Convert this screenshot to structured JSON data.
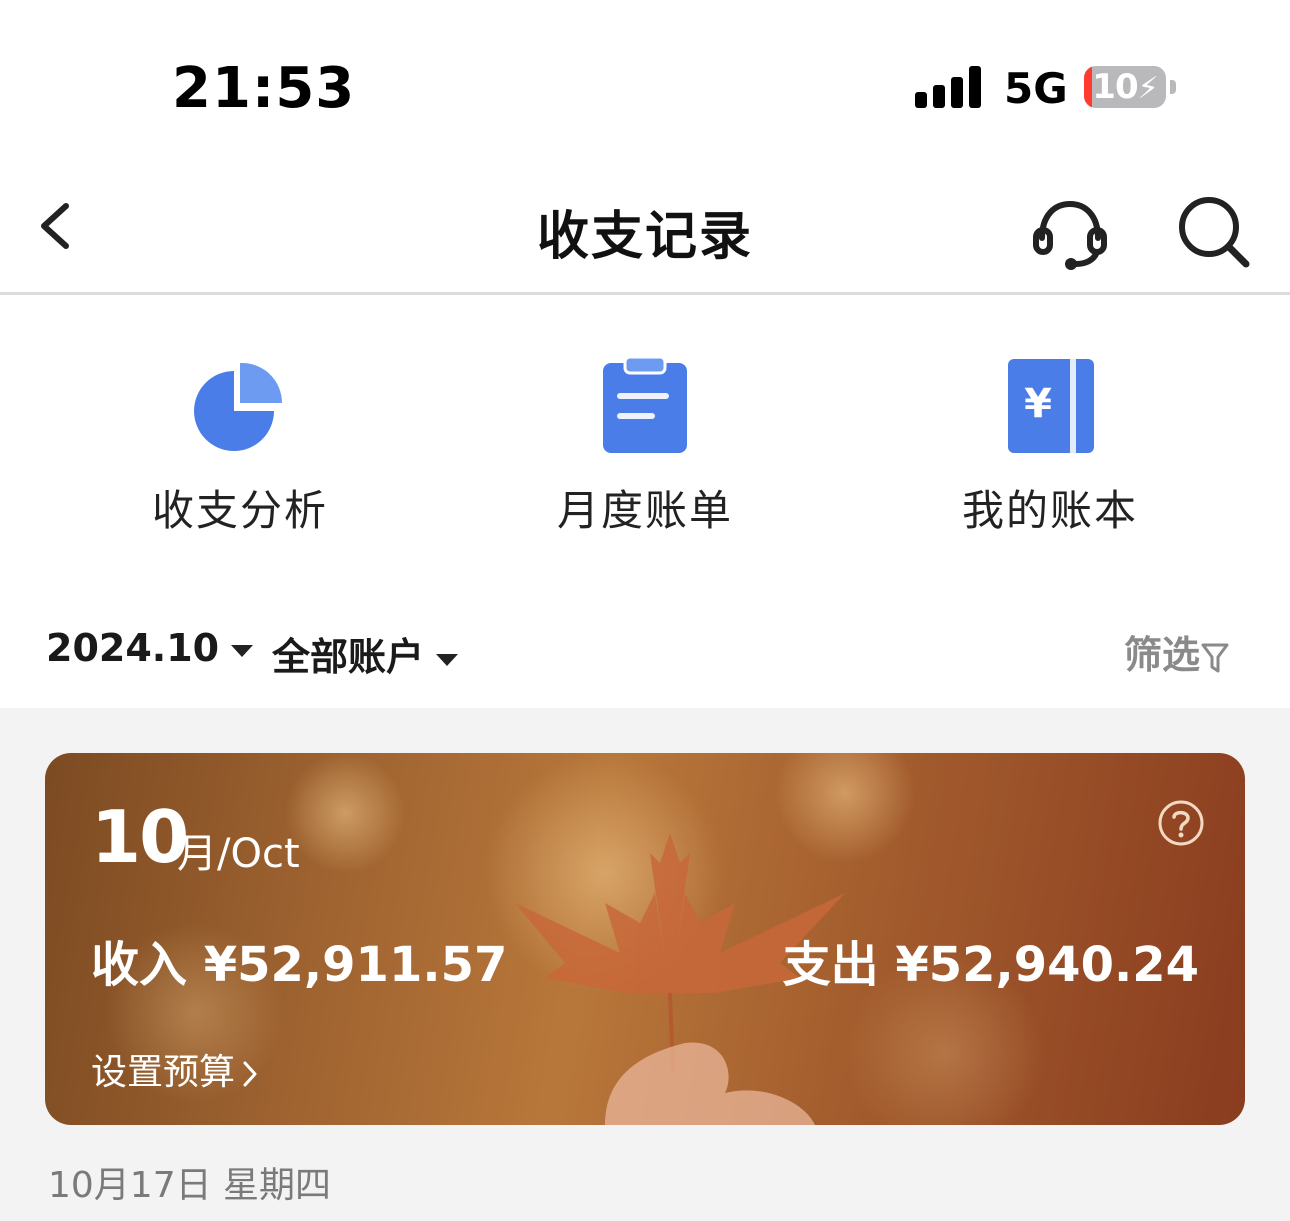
{
  "status_bar": {
    "time": "21:53",
    "network": "5G",
    "battery_percent": "10"
  },
  "nav": {
    "title": "收支记录",
    "back_icon": "chevron-left-icon",
    "service_icon": "headset-icon",
    "search_icon": "search-icon"
  },
  "shortcuts": [
    {
      "label": "收支分析",
      "icon": "pie-chart-icon"
    },
    {
      "label": "月度账单",
      "icon": "clipboard-icon"
    },
    {
      "label": "我的账本",
      "icon": "ledger-book-icon"
    }
  ],
  "filters": {
    "date": "2024.10",
    "account": "全部账户",
    "filter_label": "筛选"
  },
  "summary_card": {
    "month_number": "10",
    "month_text": "月/Oct",
    "income": "收入 ¥52,911.57",
    "expense": "支出 ¥52,940.24",
    "budget_link": "设置预算"
  },
  "date_header": "10月17日  星期四",
  "colors": {
    "accent_blue": "#4a7de8",
    "card_brown": "#a06431",
    "battery_low": "#ff3b30"
  }
}
